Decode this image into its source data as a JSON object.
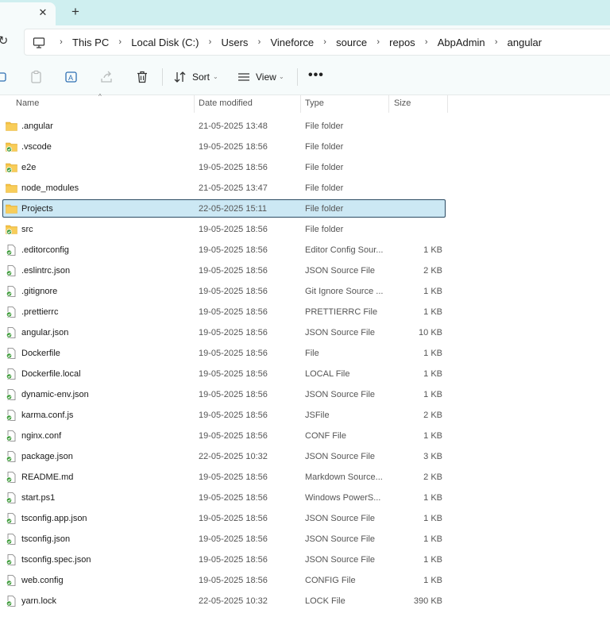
{
  "tabs": {
    "close_glyph": "✕",
    "new_glyph": "+"
  },
  "nav": {
    "refresh_glyph": "↻",
    "breadcrumbs": [
      "This PC",
      "Local Disk (C:)",
      "Users",
      "Vineforce",
      "source",
      "repos",
      "AbpAdmin",
      "angular"
    ],
    "separator": "›"
  },
  "toolbar": {
    "sort_label": "Sort",
    "view_label": "View",
    "more_label": "•••",
    "caret": "⌄"
  },
  "columns": {
    "name": "Name",
    "date": "Date modified",
    "type": "Type",
    "size": "Size",
    "sort_indicator": "^"
  },
  "colors": {
    "folder": "#f5c242",
    "selected_bg": "#cce8f4",
    "accent": "#2a4a62"
  },
  "files": [
    {
      "name": ".angular",
      "date": "21-05-2025 13:48",
      "type": "File folder",
      "size": "",
      "icon": "folder-icon"
    },
    {
      "name": ".vscode",
      "date": "19-05-2025 18:56",
      "type": "File folder",
      "size": "",
      "icon": "folder-synced-icon"
    },
    {
      "name": "e2e",
      "date": "19-05-2025 18:56",
      "type": "File folder",
      "size": "",
      "icon": "folder-synced-icon"
    },
    {
      "name": "node_modules",
      "date": "21-05-2025 13:47",
      "type": "File folder",
      "size": "",
      "icon": "folder-icon"
    },
    {
      "name": "Projects",
      "date": "22-05-2025 15:11",
      "type": "File folder",
      "size": "",
      "icon": "folder-icon",
      "selected": true
    },
    {
      "name": "src",
      "date": "19-05-2025 18:56",
      "type": "File folder",
      "size": "",
      "icon": "folder-synced-icon"
    },
    {
      "name": ".editorconfig",
      "date": "19-05-2025 18:56",
      "type": "Editor Config Sour...",
      "size": "1 KB",
      "icon": "file-synced-icon"
    },
    {
      "name": ".eslintrc.json",
      "date": "19-05-2025 18:56",
      "type": "JSON Source File",
      "size": "2 KB",
      "icon": "file-synced-icon"
    },
    {
      "name": ".gitignore",
      "date": "19-05-2025 18:56",
      "type": "Git Ignore Source ...",
      "size": "1 KB",
      "icon": "file-synced-icon"
    },
    {
      "name": ".prettierrc",
      "date": "19-05-2025 18:56",
      "type": "PRETTIERRC File",
      "size": "1 KB",
      "icon": "file-synced-icon"
    },
    {
      "name": "angular.json",
      "date": "19-05-2025 18:56",
      "type": "JSON Source File",
      "size": "10 KB",
      "icon": "file-synced-icon"
    },
    {
      "name": "Dockerfile",
      "date": "19-05-2025 18:56",
      "type": "File",
      "size": "1 KB",
      "icon": "file-synced-icon"
    },
    {
      "name": "Dockerfile.local",
      "date": "19-05-2025 18:56",
      "type": "LOCAL File",
      "size": "1 KB",
      "icon": "file-synced-icon"
    },
    {
      "name": "dynamic-env.json",
      "date": "19-05-2025 18:56",
      "type": "JSON Source File",
      "size": "1 KB",
      "icon": "file-synced-icon"
    },
    {
      "name": "karma.conf.js",
      "date": "19-05-2025 18:56",
      "type": "JSFile",
      "size": "2 KB",
      "icon": "file-synced-icon"
    },
    {
      "name": "nginx.conf",
      "date": "19-05-2025 18:56",
      "type": "CONF File",
      "size": "1 KB",
      "icon": "file-synced-icon"
    },
    {
      "name": "package.json",
      "date": "22-05-2025 10:32",
      "type": "JSON Source File",
      "size": "3 KB",
      "icon": "file-synced-icon"
    },
    {
      "name": "README.md",
      "date": "19-05-2025 18:56",
      "type": "Markdown Source...",
      "size": "2 KB",
      "icon": "file-synced-icon"
    },
    {
      "name": "start.ps1",
      "date": "19-05-2025 18:56",
      "type": "Windows PowerS...",
      "size": "1 KB",
      "icon": "file-synced-icon"
    },
    {
      "name": "tsconfig.app.json",
      "date": "19-05-2025 18:56",
      "type": "JSON Source File",
      "size": "1 KB",
      "icon": "file-synced-icon"
    },
    {
      "name": "tsconfig.json",
      "date": "19-05-2025 18:56",
      "type": "JSON Source File",
      "size": "1 KB",
      "icon": "file-synced-icon"
    },
    {
      "name": "tsconfig.spec.json",
      "date": "19-05-2025 18:56",
      "type": "JSON Source File",
      "size": "1 KB",
      "icon": "file-synced-icon"
    },
    {
      "name": "web.config",
      "date": "19-05-2025 18:56",
      "type": "CONFIG File",
      "size": "1 KB",
      "icon": "file-synced-icon"
    },
    {
      "name": "yarn.lock",
      "date": "22-05-2025 10:32",
      "type": "LOCK File",
      "size": "390 KB",
      "icon": "file-synced-icon"
    }
  ]
}
